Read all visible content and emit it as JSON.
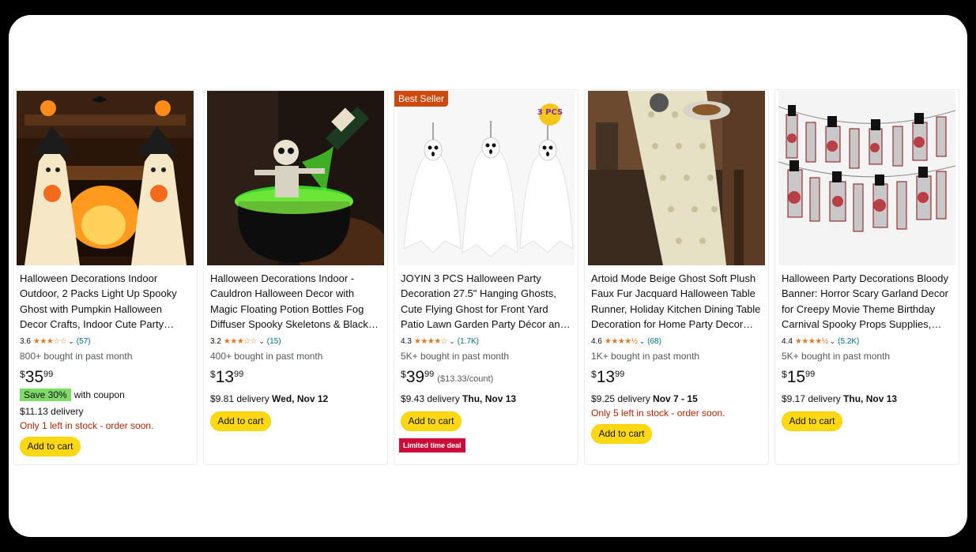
{
  "products": [
    {
      "title_lines": [
        "Halloween Decorations Indoor",
        "Outdoor, 2 Packs Light Up Spooky",
        "Ghost with Pumpkin Halloween",
        "Decor Crafts, Indoor Cute Party…"
      ],
      "rating": "3.6",
      "stars": "★★★☆☆",
      "reviews": "(57)",
      "bought": "800+ bought in past month",
      "price_symbol": "$",
      "price_whole": "35",
      "price_fraction": "99",
      "coupon_tag": "Save 30%",
      "coupon_text": "with coupon",
      "delivery_text": "$11.13 delivery",
      "stock": "Only 1 left in stock - order soon.",
      "cart_label": "Add to cart"
    },
    {
      "title_lines": [
        "Halloween Decorations Indoor -",
        "Cauldron Halloween Decor with",
        "Magic Floating Potion Bottles Fog",
        "Diffuser Spooky Skeletons & Black…"
      ],
      "rating": "3.2",
      "stars": "★★★☆☆",
      "reviews": "(15)",
      "bought": "400+ bought in past month",
      "price_symbol": "$",
      "price_whole": "13",
      "price_fraction": "99",
      "delivery_text": "$9.81 delivery ",
      "delivery_date": "Wed, Nov 12",
      "cart_label": "Add to cart"
    },
    {
      "badge": "Best Seller",
      "title_lines": [
        "JOYIN 3 PCS Halloween Party",
        "Decoration 27.5\" Hanging Ghosts,",
        "Cute Flying Ghost for Front Yard",
        "Patio Lawn Garden Party Décor and…"
      ],
      "rating": "4.3",
      "stars": "★★★★☆",
      "reviews": "(1.7K)",
      "bought": "5K+ bought in past month",
      "price_symbol": "$",
      "price_whole": "39",
      "price_fraction": "99",
      "unit_price": "($13.33/count)",
      "delivery_text": "$9.43 delivery ",
      "delivery_date": "Thu, Nov 13",
      "cart_label": "Add to cart",
      "deal": "Limited time deal",
      "image_badge": "3 PCS"
    },
    {
      "title_lines": [
        "Artoid Mode Beige Ghost Soft Plush",
        "Faux Fur Jacquard Halloween Table",
        "Runner, Holiday Kitchen Dining Table",
        "Decoration for Home Party Decor…"
      ],
      "rating": "4.6",
      "stars": "★★★★½",
      "reviews": "(68)",
      "bought": "1K+ bought in past month",
      "price_symbol": "$",
      "price_whole": "13",
      "price_fraction": "99",
      "delivery_text": "$9.25 delivery ",
      "delivery_date": "Nov 7 - 15",
      "stock": "Only 5 left in stock - order soon.",
      "cart_label": "Add to cart"
    },
    {
      "title_lines": [
        "Halloween Party Decorations Bloody",
        "Banner: Horror Scary Garland Decor",
        "for Creepy Movie Theme Birthday",
        "Carnival Spooky Props Supplies,…"
      ],
      "rating": "4.4",
      "stars": "★★★★½",
      "reviews": "(5.2K)",
      "bought": "5K+ bought in past month",
      "price_symbol": "$",
      "price_whole": "15",
      "price_fraction": "99",
      "delivery_text": "$9.17 delivery ",
      "delivery_date": "Thu, Nov 13",
      "cart_label": "Add to cart"
    }
  ],
  "colors": {
    "cart_button": "#ffd814",
    "badge": "#cc4b0c",
    "deal": "#cc0c39",
    "stars": "#de7921",
    "link": "#007185",
    "stock_warning": "#b12704",
    "coupon": "#7fda69"
  },
  "icons": [
    "chevron-down-icon",
    "star-rating-icon"
  ]
}
